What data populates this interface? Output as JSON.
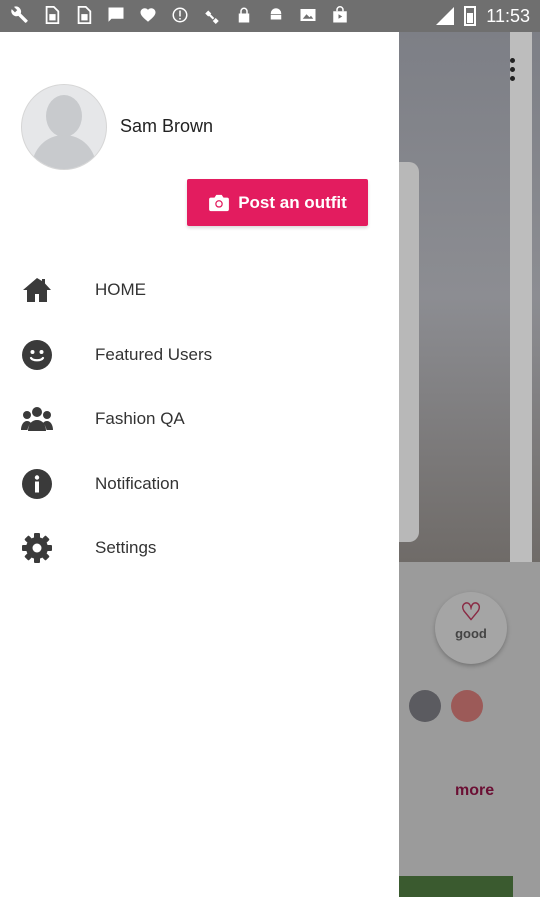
{
  "statusbar": {
    "time": "11:53",
    "icons": [
      "wrench-icon",
      "sim-icon",
      "sim-icon",
      "chat-icon",
      "heart-icon",
      "alert-icon",
      "satellite-icon",
      "lock-icon",
      "android-icon",
      "photo-icon",
      "shopping-bag-icon"
    ]
  },
  "drawer": {
    "user_name": "Sam Brown",
    "post_button_label": "Post an outfit",
    "menu": [
      {
        "label": "HOME",
        "icon": "home-icon"
      },
      {
        "label": "Featured Users",
        "icon": "smiley-icon"
      },
      {
        "label": "Fashion QA",
        "icon": "users-group-icon"
      },
      {
        "label": "Notification",
        "icon": "info-icon"
      },
      {
        "label": "Settings",
        "icon": "gear-icon"
      }
    ]
  },
  "background": {
    "good_label": "good",
    "more_label": "more"
  },
  "colors": {
    "accent": "#e31c5f",
    "icon": "#3a3a3a"
  }
}
